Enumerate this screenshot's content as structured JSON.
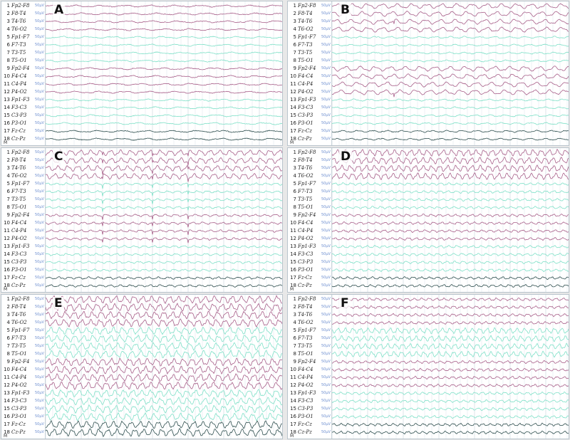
{
  "scale_label": "50µV",
  "marker_label": "M",
  "colors": {
    "temporal": "#a8608a",
    "parasagittal": "#7fe0c8",
    "midline": "#2f4f4f",
    "grid": "#d4dde3"
  },
  "channels": [
    {
      "num": "1",
      "name": "Fp2-F8",
      "group": "temporal"
    },
    {
      "num": "2",
      "name": "F8-T4",
      "group": "temporal"
    },
    {
      "num": "3",
      "name": "T4-T6",
      "group": "temporal"
    },
    {
      "num": "4",
      "name": "T6-O2",
      "group": "temporal"
    },
    {
      "num": "5",
      "name": "Fp1-F7",
      "group": "parasagittal"
    },
    {
      "num": "6",
      "name": "F7-T3",
      "group": "parasagittal"
    },
    {
      "num": "7",
      "name": "T3-T5",
      "group": "parasagittal"
    },
    {
      "num": "8",
      "name": "T5-O1",
      "group": "parasagittal"
    },
    {
      "num": "9",
      "name": "Fp2-F4",
      "group": "temporal"
    },
    {
      "num": "10",
      "name": "F4-C4",
      "group": "temporal"
    },
    {
      "num": "11",
      "name": "C4-P4",
      "group": "temporal"
    },
    {
      "num": "12",
      "name": "P4-O2",
      "group": "temporal"
    },
    {
      "num": "13",
      "name": "Fp1-F3",
      "group": "parasagittal"
    },
    {
      "num": "14",
      "name": "F3-C3",
      "group": "parasagittal"
    },
    {
      "num": "15",
      "name": "C3-P3",
      "group": "parasagittal"
    },
    {
      "num": "16",
      "name": "P3-O1",
      "group": "parasagittal"
    },
    {
      "num": "17",
      "name": "Fz-Cz",
      "group": "midline"
    },
    {
      "num": "18",
      "name": "Cz-Pz",
      "group": "midline"
    }
  ],
  "panels": [
    {
      "letter": "A",
      "pattern": "low",
      "seed": 1
    },
    {
      "letter": "B",
      "pattern": "right",
      "seed": 2
    },
    {
      "letter": "C",
      "pattern": "spikes",
      "seed": 3
    },
    {
      "letter": "D",
      "pattern": "rhythmic",
      "seed": 4
    },
    {
      "letter": "E",
      "pattern": "seizure",
      "seed": 5
    },
    {
      "letter": "F",
      "pattern": "post",
      "seed": 6
    }
  ]
}
